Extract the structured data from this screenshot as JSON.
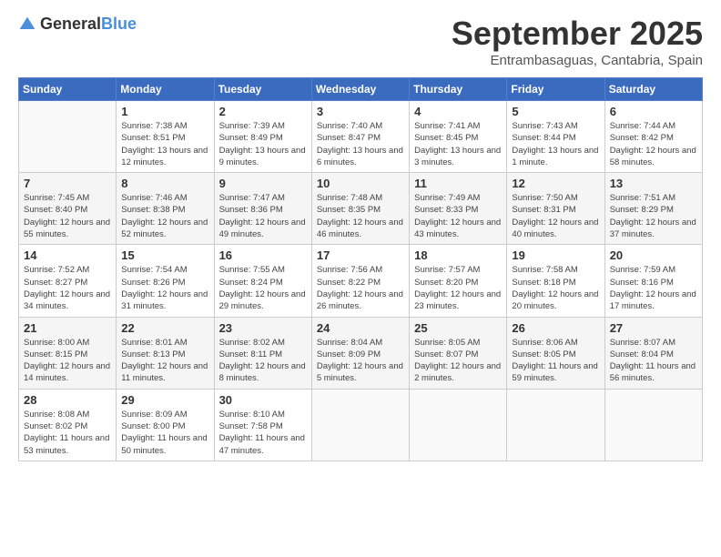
{
  "header": {
    "logo_general": "General",
    "logo_blue": "Blue",
    "month": "September 2025",
    "location": "Entrambasaguas, Cantabria, Spain"
  },
  "days_of_week": [
    "Sunday",
    "Monday",
    "Tuesday",
    "Wednesday",
    "Thursday",
    "Friday",
    "Saturday"
  ],
  "weeks": [
    [
      {
        "day": "",
        "sunrise": "",
        "sunset": "",
        "daylight": ""
      },
      {
        "day": "1",
        "sunrise": "Sunrise: 7:38 AM",
        "sunset": "Sunset: 8:51 PM",
        "daylight": "Daylight: 13 hours and 12 minutes."
      },
      {
        "day": "2",
        "sunrise": "Sunrise: 7:39 AM",
        "sunset": "Sunset: 8:49 PM",
        "daylight": "Daylight: 13 hours and 9 minutes."
      },
      {
        "day": "3",
        "sunrise": "Sunrise: 7:40 AM",
        "sunset": "Sunset: 8:47 PM",
        "daylight": "Daylight: 13 hours and 6 minutes."
      },
      {
        "day": "4",
        "sunrise": "Sunrise: 7:41 AM",
        "sunset": "Sunset: 8:45 PM",
        "daylight": "Daylight: 13 hours and 3 minutes."
      },
      {
        "day": "5",
        "sunrise": "Sunrise: 7:43 AM",
        "sunset": "Sunset: 8:44 PM",
        "daylight": "Daylight: 13 hours and 1 minute."
      },
      {
        "day": "6",
        "sunrise": "Sunrise: 7:44 AM",
        "sunset": "Sunset: 8:42 PM",
        "daylight": "Daylight: 12 hours and 58 minutes."
      }
    ],
    [
      {
        "day": "7",
        "sunrise": "Sunrise: 7:45 AM",
        "sunset": "Sunset: 8:40 PM",
        "daylight": "Daylight: 12 hours and 55 minutes."
      },
      {
        "day": "8",
        "sunrise": "Sunrise: 7:46 AM",
        "sunset": "Sunset: 8:38 PM",
        "daylight": "Daylight: 12 hours and 52 minutes."
      },
      {
        "day": "9",
        "sunrise": "Sunrise: 7:47 AM",
        "sunset": "Sunset: 8:36 PM",
        "daylight": "Daylight: 12 hours and 49 minutes."
      },
      {
        "day": "10",
        "sunrise": "Sunrise: 7:48 AM",
        "sunset": "Sunset: 8:35 PM",
        "daylight": "Daylight: 12 hours and 46 minutes."
      },
      {
        "day": "11",
        "sunrise": "Sunrise: 7:49 AM",
        "sunset": "Sunset: 8:33 PM",
        "daylight": "Daylight: 12 hours and 43 minutes."
      },
      {
        "day": "12",
        "sunrise": "Sunrise: 7:50 AM",
        "sunset": "Sunset: 8:31 PM",
        "daylight": "Daylight: 12 hours and 40 minutes."
      },
      {
        "day": "13",
        "sunrise": "Sunrise: 7:51 AM",
        "sunset": "Sunset: 8:29 PM",
        "daylight": "Daylight: 12 hours and 37 minutes."
      }
    ],
    [
      {
        "day": "14",
        "sunrise": "Sunrise: 7:52 AM",
        "sunset": "Sunset: 8:27 PM",
        "daylight": "Daylight: 12 hours and 34 minutes."
      },
      {
        "day": "15",
        "sunrise": "Sunrise: 7:54 AM",
        "sunset": "Sunset: 8:26 PM",
        "daylight": "Daylight: 12 hours and 31 minutes."
      },
      {
        "day": "16",
        "sunrise": "Sunrise: 7:55 AM",
        "sunset": "Sunset: 8:24 PM",
        "daylight": "Daylight: 12 hours and 29 minutes."
      },
      {
        "day": "17",
        "sunrise": "Sunrise: 7:56 AM",
        "sunset": "Sunset: 8:22 PM",
        "daylight": "Daylight: 12 hours and 26 minutes."
      },
      {
        "day": "18",
        "sunrise": "Sunrise: 7:57 AM",
        "sunset": "Sunset: 8:20 PM",
        "daylight": "Daylight: 12 hours and 23 minutes."
      },
      {
        "day": "19",
        "sunrise": "Sunrise: 7:58 AM",
        "sunset": "Sunset: 8:18 PM",
        "daylight": "Daylight: 12 hours and 20 minutes."
      },
      {
        "day": "20",
        "sunrise": "Sunrise: 7:59 AM",
        "sunset": "Sunset: 8:16 PM",
        "daylight": "Daylight: 12 hours and 17 minutes."
      }
    ],
    [
      {
        "day": "21",
        "sunrise": "Sunrise: 8:00 AM",
        "sunset": "Sunset: 8:15 PM",
        "daylight": "Daylight: 12 hours and 14 minutes."
      },
      {
        "day": "22",
        "sunrise": "Sunrise: 8:01 AM",
        "sunset": "Sunset: 8:13 PM",
        "daylight": "Daylight: 12 hours and 11 minutes."
      },
      {
        "day": "23",
        "sunrise": "Sunrise: 8:02 AM",
        "sunset": "Sunset: 8:11 PM",
        "daylight": "Daylight: 12 hours and 8 minutes."
      },
      {
        "day": "24",
        "sunrise": "Sunrise: 8:04 AM",
        "sunset": "Sunset: 8:09 PM",
        "daylight": "Daylight: 12 hours and 5 minutes."
      },
      {
        "day": "25",
        "sunrise": "Sunrise: 8:05 AM",
        "sunset": "Sunset: 8:07 PM",
        "daylight": "Daylight: 12 hours and 2 minutes."
      },
      {
        "day": "26",
        "sunrise": "Sunrise: 8:06 AM",
        "sunset": "Sunset: 8:05 PM",
        "daylight": "Daylight: 11 hours and 59 minutes."
      },
      {
        "day": "27",
        "sunrise": "Sunrise: 8:07 AM",
        "sunset": "Sunset: 8:04 PM",
        "daylight": "Daylight: 11 hours and 56 minutes."
      }
    ],
    [
      {
        "day": "28",
        "sunrise": "Sunrise: 8:08 AM",
        "sunset": "Sunset: 8:02 PM",
        "daylight": "Daylight: 11 hours and 53 minutes."
      },
      {
        "day": "29",
        "sunrise": "Sunrise: 8:09 AM",
        "sunset": "Sunset: 8:00 PM",
        "daylight": "Daylight: 11 hours and 50 minutes."
      },
      {
        "day": "30",
        "sunrise": "Sunrise: 8:10 AM",
        "sunset": "Sunset: 7:58 PM",
        "daylight": "Daylight: 11 hours and 47 minutes."
      },
      {
        "day": "",
        "sunrise": "",
        "sunset": "",
        "daylight": ""
      },
      {
        "day": "",
        "sunrise": "",
        "sunset": "",
        "daylight": ""
      },
      {
        "day": "",
        "sunrise": "",
        "sunset": "",
        "daylight": ""
      },
      {
        "day": "",
        "sunrise": "",
        "sunset": "",
        "daylight": ""
      }
    ]
  ]
}
